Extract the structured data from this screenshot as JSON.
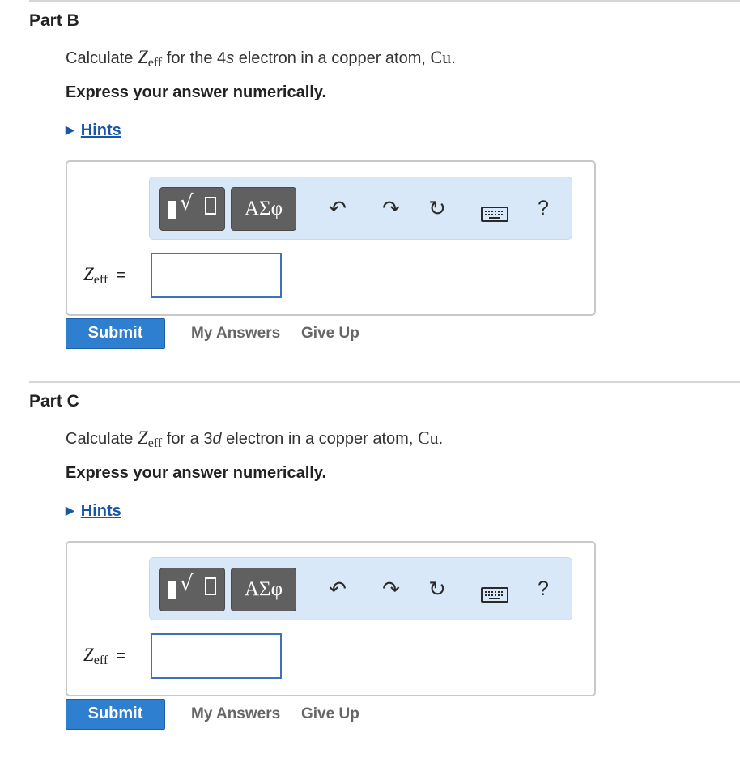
{
  "parts": [
    {
      "title": "Part B",
      "question": {
        "prefix": "Calculate ",
        "var": "Z",
        "sub": "eff",
        "middle_1": " for the 4",
        "orbital": "s",
        "middle_2": " electron in a copper atom, ",
        "element": "Cu",
        "suffix": "."
      },
      "instruction": "Express your answer numerically.",
      "hints_label": "Hints",
      "toolbar": {
        "templates_icon": "templates-icon",
        "greek_label": "ΑΣφ",
        "undo_icon": "undo-icon",
        "redo_icon": "redo-icon",
        "reset_icon": "reset-icon",
        "keyboard_icon": "keyboard-icon",
        "help_label": "?"
      },
      "answer_label": {
        "var": "Z",
        "sub": "eff",
        "eq": "="
      },
      "answer_value": "",
      "submit_label": "Submit",
      "my_answers_label": "My Answers",
      "give_up_label": "Give Up"
    },
    {
      "title": "Part C",
      "question": {
        "prefix": "Calculate ",
        "var": "Z",
        "sub": "eff",
        "middle_1": " for a 3",
        "orbital": "d",
        "middle_2": " electron in a copper atom, ",
        "element": "Cu",
        "suffix": "."
      },
      "instruction": "Express your answer numerically.",
      "hints_label": "Hints",
      "toolbar": {
        "templates_icon": "templates-icon",
        "greek_label": "ΑΣφ",
        "undo_icon": "undo-icon",
        "redo_icon": "redo-icon",
        "reset_icon": "reset-icon",
        "keyboard_icon": "keyboard-icon",
        "help_label": "?"
      },
      "answer_label": {
        "var": "Z",
        "sub": "eff",
        "eq": "="
      },
      "answer_value": "",
      "submit_label": "Submit",
      "my_answers_label": "My Answers",
      "give_up_label": "Give Up"
    }
  ],
  "colors": {
    "link": "#1a56a8",
    "submit_bg": "#2f7fd1",
    "toolbar_bg": "#d9e8f8",
    "toolbar_button": "#606060",
    "input_border": "#3b73b9"
  }
}
